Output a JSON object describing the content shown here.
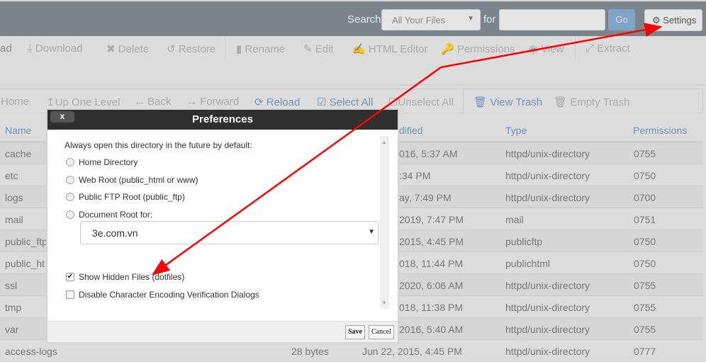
{
  "topbar": {
    "search_label": "Search",
    "scope": "All Your Files",
    "for_label": "for",
    "search_value": "",
    "go": "Go",
    "settings": "Settings"
  },
  "toolbar": [
    "ad",
    "Download",
    "Delete",
    "Restore",
    "Rename",
    "Edit",
    "HTML Editor",
    "Permissions",
    "View",
    "Extract"
  ],
  "nav": [
    "Home",
    "Up One Level",
    "Back",
    "Forward",
    "Reload",
    "Select All",
    "Unselect All",
    "View Trash",
    "Empty Trash"
  ],
  "table": {
    "headers": {
      "name": "Name",
      "modified": "dified",
      "type": "Type",
      "perms": "Permissions"
    },
    "rows": [
      {
        "name": "cache",
        "size": "",
        "modified": "016, 5:37 AM",
        "type": "httpd/unix-directory",
        "perms": "0755"
      },
      {
        "name": "etc",
        "size": "",
        "modified": ":34 PM",
        "type": "httpd/unix-directory",
        "perms": "0750"
      },
      {
        "name": "logs",
        "size": "",
        "modified": "ay, 7:49 PM",
        "type": "httpd/unix-directory",
        "perms": "0700"
      },
      {
        "name": "mail",
        "size": "",
        "modified": "2019, 7:47 PM",
        "type": "mail",
        "perms": "0751"
      },
      {
        "name": "public_ftp",
        "size": "",
        "modified": "2015, 4:45 PM",
        "type": "publicftp",
        "perms": "0750"
      },
      {
        "name": "public_ht",
        "size": "",
        "modified": "018, 11:44 PM",
        "type": "publichtml",
        "perms": "0750"
      },
      {
        "name": "ssl",
        "size": "",
        "modified": "2020, 6:06 AM",
        "type": "httpd/unix-directory",
        "perms": "0755"
      },
      {
        "name": "tmp",
        "size": "",
        "modified": "018, 11:38 PM",
        "type": "httpd/unix-directory",
        "perms": "0755"
      },
      {
        "name": "var",
        "size": "",
        "modified": "2016, 5:40 AM",
        "type": "httpd/unix-directory",
        "perms": "0755"
      },
      {
        "name": "access-logs",
        "size": "28 bytes",
        "modified": "Jun 22, 2015, 4:45 PM",
        "type": "httpd/unix-directory",
        "perms": "0777"
      }
    ]
  },
  "modal": {
    "title": "Preferences",
    "close": "x",
    "intro": "Always open this directory in the future by default:",
    "options": [
      "Home Directory",
      "Web Root (public_html or www)",
      "Public FTP Root (public_ftp)",
      "Document Root for:"
    ],
    "domain": "3e.com.vn",
    "show_hidden": {
      "label": "Show Hidden Files (dotfiles)",
      "checked": true
    },
    "disable_enc": {
      "label": "Disable Character Encoding Verification Dialogs",
      "checked": false
    },
    "save": "Save",
    "cancel": "Cancel"
  },
  "annotation_color": "#ff0000"
}
